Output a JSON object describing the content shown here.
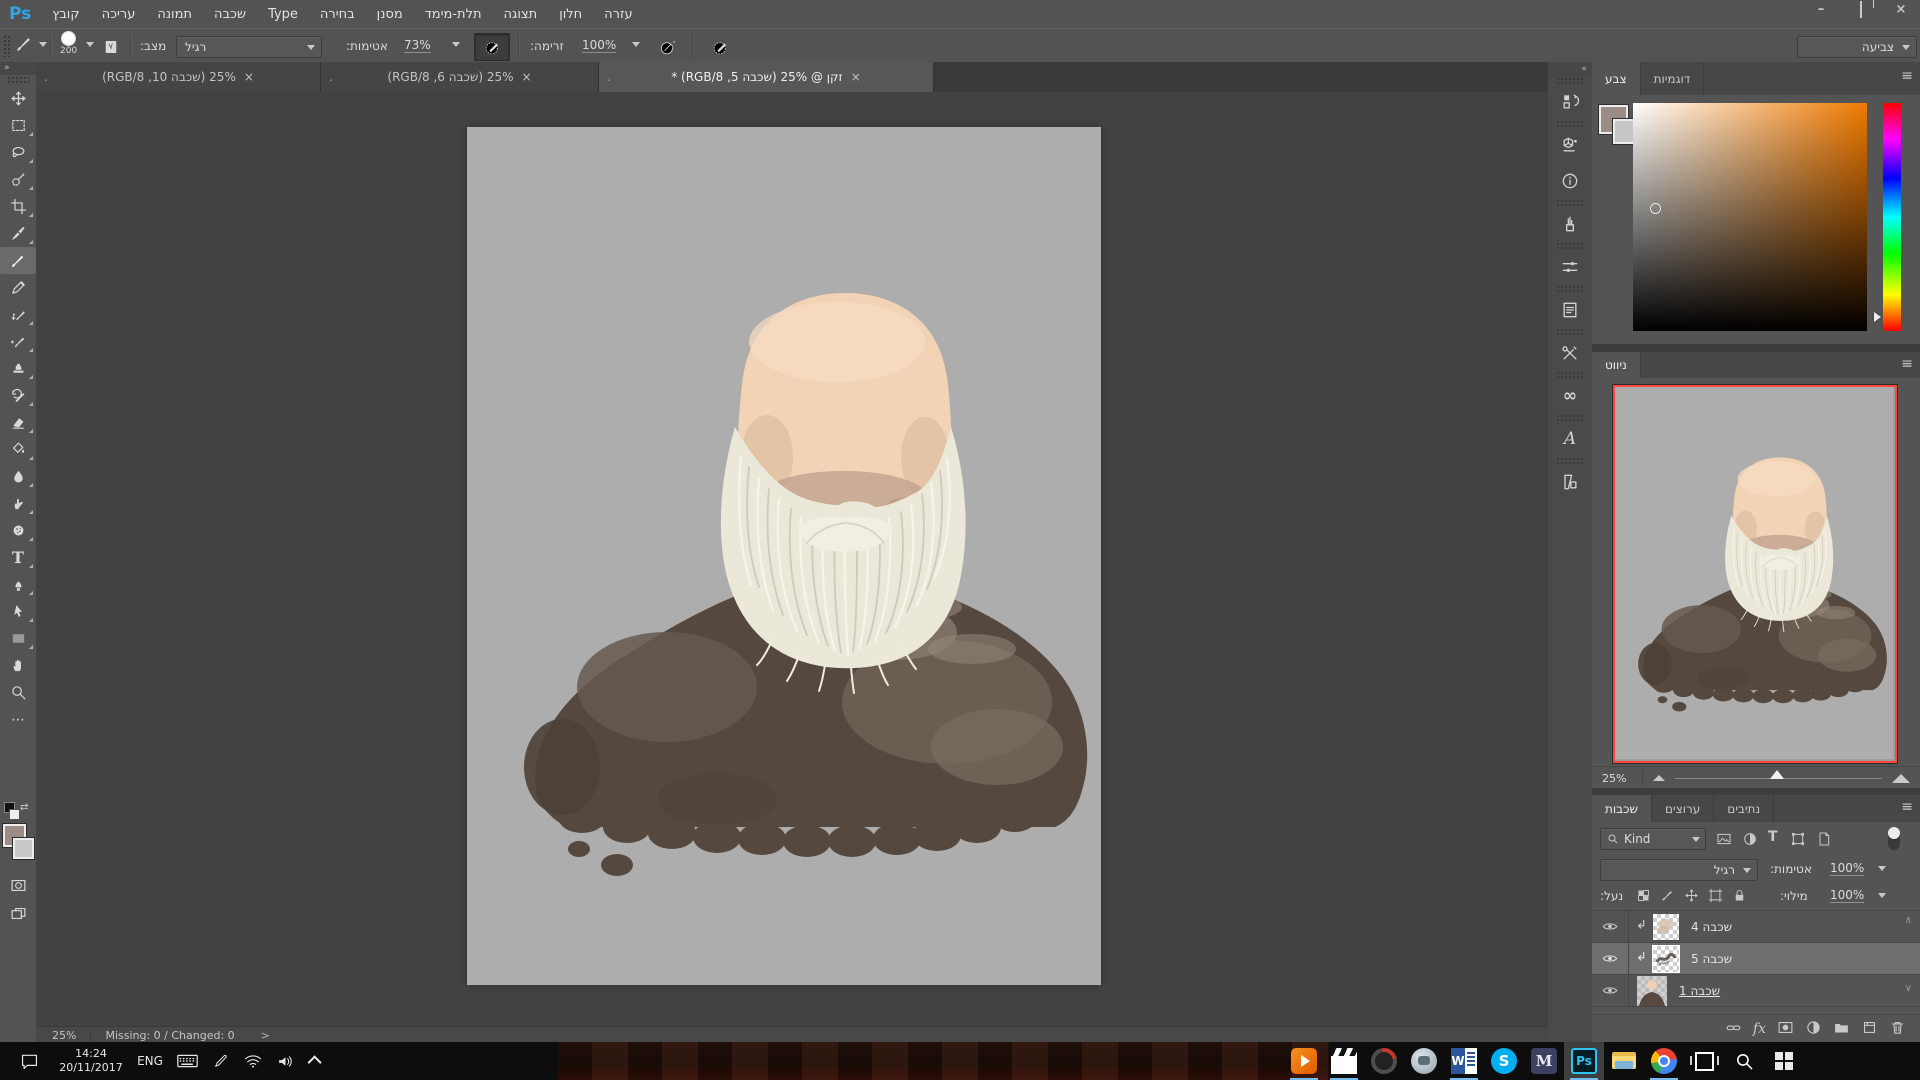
{
  "titlebar": {
    "logo": "Ps",
    "menus": [
      "קובץ",
      "עריכה",
      "תמונה",
      "שכבה",
      "Type",
      "בחירה",
      "מסנן",
      "תלת-מימד",
      "תצוגה",
      "חלון",
      "עזרה"
    ],
    "minimize": "–",
    "close": "×"
  },
  "options": {
    "brush_size": "200",
    "mode_label": "מצב:",
    "mode_value": "רגיל",
    "opacity_label": "אטימות:",
    "opacity_value": "73%",
    "flow_label": "זרימה:",
    "flow_value": "100%",
    "workspace": "צביעה"
  },
  "doc_tabs": {
    "tab1": "25% (שכבה 10, RGB/8)",
    "tab2": "25% (שכבה 6, RGB/8)",
    "tab3": "זקן @ 25% (שכבה 5, RGB/8) *",
    "close": "×",
    "dot": "."
  },
  "color_panel": {
    "tab_color": "צבע",
    "tab_swatches": "דוגמיות"
  },
  "navigator": {
    "tab": "ניווט",
    "zoom": "25%"
  },
  "layers_panel": {
    "tab_layers": "שכבות",
    "tab_channels": "ערוצים",
    "tab_paths": "נתיבים",
    "filter": "Kind",
    "blend": "רגיל",
    "opacity_label": "אטימות:",
    "opacity_value": "100%",
    "lock_label": "נעל:",
    "fill_label": "מילוי:",
    "fill_value": "100%",
    "layers": [
      {
        "name": "שכבה 4"
      },
      {
        "name": "שכבה 5"
      },
      {
        "name": "שכבה 1"
      }
    ]
  },
  "statusbar": {
    "zoom": "25%",
    "info": "Missing: 0 / Changed: 0",
    "expand": ">"
  },
  "taskbar": {
    "time": "14:24",
    "date": "20/11/2017",
    "lang": "ENG"
  },
  "icons": {
    "panel_menu": "≡",
    "more_tools": "⋯",
    "collapse": "«",
    "expand": "»",
    "scroll_up": "∧",
    "scroll_down": "∨",
    "type_tool": "T",
    "fx": "fx",
    "glyphs": "A",
    "cc": "∞",
    "word": "W",
    "skype": "S",
    "maple": "M",
    "ps_badge": "Ps",
    "info": "i"
  }
}
